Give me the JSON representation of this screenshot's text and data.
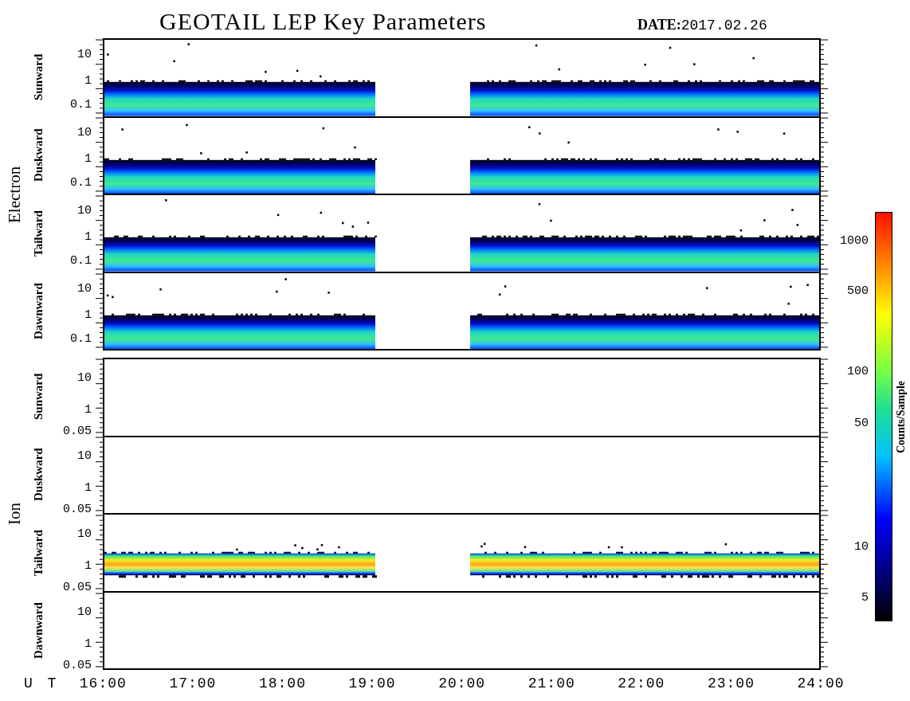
{
  "title": "GEOTAIL LEP Key Parameters",
  "date": {
    "label": "DATE:",
    "value": "2017.02.26"
  },
  "groups": [
    {
      "label": "Electron",
      "kind": "electron",
      "panels": [
        {
          "label": "Sunward",
          "has_data": true,
          "y_ticks": [
            "10",
            "1",
            "0.1"
          ]
        },
        {
          "label": "Duskward",
          "has_data": true,
          "y_ticks": [
            "10",
            "1",
            "0.1"
          ]
        },
        {
          "label": "Tailward",
          "has_data": true,
          "y_ticks": [
            "10",
            "1",
            "0.1"
          ]
        },
        {
          "label": "Dawnward",
          "has_data": true,
          "y_ticks": [
            "10",
            "1",
            "0.1"
          ]
        }
      ]
    },
    {
      "label": "Ion",
      "kind": "ion",
      "panels": [
        {
          "label": "Sunward",
          "has_data": false,
          "y_ticks": [
            "10",
            "1",
            "0.05"
          ]
        },
        {
          "label": "Duskward",
          "has_data": false,
          "y_ticks": [
            "10",
            "1",
            "0.05"
          ]
        },
        {
          "label": "Tailward",
          "has_data": true,
          "y_ticks": [
            "10",
            "1",
            "0.05"
          ]
        },
        {
          "label": "Dawnward",
          "has_data": false,
          "y_ticks": [
            "10",
            "1",
            "0.05"
          ]
        }
      ]
    }
  ],
  "x_axis": {
    "label": "U T",
    "ticks": [
      "16:00",
      "17:00",
      "18:00",
      "19:00",
      "20:00",
      "21:00",
      "22:00",
      "23:00",
      "24:00"
    ]
  },
  "colorbar": {
    "label": "Counts/Sample",
    "ticks": [
      "1000",
      "500",
      "100",
      "50",
      "10",
      "5"
    ]
  }
}
